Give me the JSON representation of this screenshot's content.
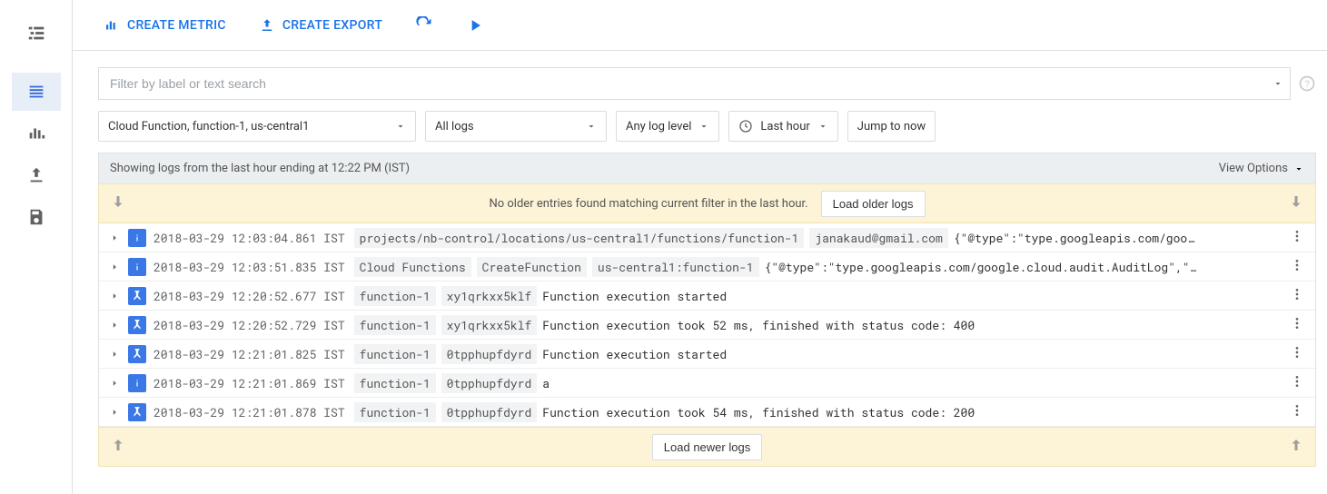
{
  "toolbar": {
    "create_metric": "CREATE METRIC",
    "create_export": "CREATE EXPORT"
  },
  "search": {
    "placeholder": "Filter by label or text search"
  },
  "filters": {
    "resource": "Cloud Function, function-1, us-central1",
    "log": "All logs",
    "level": "Any log level",
    "time": "Last hour",
    "jump": "Jump to now"
  },
  "status": {
    "text": "Showing logs from the last hour ending at 12:22 PM (IST)",
    "view_options": "View Options"
  },
  "older": {
    "msg": "No older entries found matching current filter in the last hour.",
    "button": "Load older logs"
  },
  "newer": {
    "button": "Load newer logs"
  },
  "rows": [
    {
      "level": "info",
      "ts": "2018-03-29 12:03:04.861 IST",
      "segs": [
        "projects/nb-control/locations/us-central1/functions/function-1",
        "janakaud@gmail.com"
      ],
      "text": "{\"@type\":\"type.googleapis.com/goo…"
    },
    {
      "level": "info",
      "ts": "2018-03-29 12:03:51.835 IST",
      "segs": [
        "Cloud Functions",
        "CreateFunction",
        "us-central1:function-1"
      ],
      "text": "{\"@type\":\"type.googleapis.com/google.cloud.audit.AuditLog\",\"…"
    },
    {
      "level": "debug",
      "ts": "2018-03-29 12:20:52.677 IST",
      "segs": [
        "function-1",
        "xy1qrkxx5klf"
      ],
      "text": "Function execution started"
    },
    {
      "level": "debug",
      "ts": "2018-03-29 12:20:52.729 IST",
      "segs": [
        "function-1",
        "xy1qrkxx5klf"
      ],
      "text": "Function execution took 52 ms, finished with status code: 400"
    },
    {
      "level": "debug",
      "ts": "2018-03-29 12:21:01.825 IST",
      "segs": [
        "function-1",
        "0tpphupfdyrd"
      ],
      "text": "Function execution started"
    },
    {
      "level": "info",
      "ts": "2018-03-29 12:21:01.869 IST",
      "segs": [
        "function-1",
        "0tpphupfdyrd"
      ],
      "text": "a"
    },
    {
      "level": "debug",
      "ts": "2018-03-29 12:21:01.878 IST",
      "segs": [
        "function-1",
        "0tpphupfdyrd"
      ],
      "text": "Function execution took 54 ms, finished with status code: 200"
    }
  ]
}
